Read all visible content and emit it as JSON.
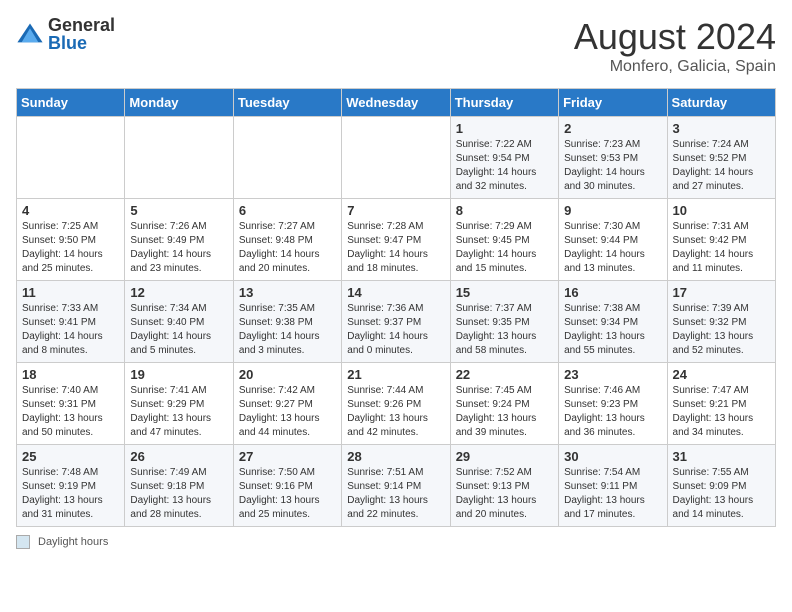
{
  "logo": {
    "general": "General",
    "blue": "Blue"
  },
  "title": {
    "month_year": "August 2024",
    "location": "Monfero, Galicia, Spain"
  },
  "days_of_week": [
    "Sunday",
    "Monday",
    "Tuesday",
    "Wednesday",
    "Thursday",
    "Friday",
    "Saturday"
  ],
  "weeks": [
    [
      {
        "day": "",
        "sunrise": "",
        "sunset": "",
        "daylight": ""
      },
      {
        "day": "",
        "sunrise": "",
        "sunset": "",
        "daylight": ""
      },
      {
        "day": "",
        "sunrise": "",
        "sunset": "",
        "daylight": ""
      },
      {
        "day": "",
        "sunrise": "",
        "sunset": "",
        "daylight": ""
      },
      {
        "day": "1",
        "sunrise": "Sunrise: 7:22 AM",
        "sunset": "Sunset: 9:54 PM",
        "daylight": "Daylight: 14 hours and 32 minutes."
      },
      {
        "day": "2",
        "sunrise": "Sunrise: 7:23 AM",
        "sunset": "Sunset: 9:53 PM",
        "daylight": "Daylight: 14 hours and 30 minutes."
      },
      {
        "day": "3",
        "sunrise": "Sunrise: 7:24 AM",
        "sunset": "Sunset: 9:52 PM",
        "daylight": "Daylight: 14 hours and 27 minutes."
      }
    ],
    [
      {
        "day": "4",
        "sunrise": "Sunrise: 7:25 AM",
        "sunset": "Sunset: 9:50 PM",
        "daylight": "Daylight: 14 hours and 25 minutes."
      },
      {
        "day": "5",
        "sunrise": "Sunrise: 7:26 AM",
        "sunset": "Sunset: 9:49 PM",
        "daylight": "Daylight: 14 hours and 23 minutes."
      },
      {
        "day": "6",
        "sunrise": "Sunrise: 7:27 AM",
        "sunset": "Sunset: 9:48 PM",
        "daylight": "Daylight: 14 hours and 20 minutes."
      },
      {
        "day": "7",
        "sunrise": "Sunrise: 7:28 AM",
        "sunset": "Sunset: 9:47 PM",
        "daylight": "Daylight: 14 hours and 18 minutes."
      },
      {
        "day": "8",
        "sunrise": "Sunrise: 7:29 AM",
        "sunset": "Sunset: 9:45 PM",
        "daylight": "Daylight: 14 hours and 15 minutes."
      },
      {
        "day": "9",
        "sunrise": "Sunrise: 7:30 AM",
        "sunset": "Sunset: 9:44 PM",
        "daylight": "Daylight: 14 hours and 13 minutes."
      },
      {
        "day": "10",
        "sunrise": "Sunrise: 7:31 AM",
        "sunset": "Sunset: 9:42 PM",
        "daylight": "Daylight: 14 hours and 11 minutes."
      }
    ],
    [
      {
        "day": "11",
        "sunrise": "Sunrise: 7:33 AM",
        "sunset": "Sunset: 9:41 PM",
        "daylight": "Daylight: 14 hours and 8 minutes."
      },
      {
        "day": "12",
        "sunrise": "Sunrise: 7:34 AM",
        "sunset": "Sunset: 9:40 PM",
        "daylight": "Daylight: 14 hours and 5 minutes."
      },
      {
        "day": "13",
        "sunrise": "Sunrise: 7:35 AM",
        "sunset": "Sunset: 9:38 PM",
        "daylight": "Daylight: 14 hours and 3 minutes."
      },
      {
        "day": "14",
        "sunrise": "Sunrise: 7:36 AM",
        "sunset": "Sunset: 9:37 PM",
        "daylight": "Daylight: 14 hours and 0 minutes."
      },
      {
        "day": "15",
        "sunrise": "Sunrise: 7:37 AM",
        "sunset": "Sunset: 9:35 PM",
        "daylight": "Daylight: 13 hours and 58 minutes."
      },
      {
        "day": "16",
        "sunrise": "Sunrise: 7:38 AM",
        "sunset": "Sunset: 9:34 PM",
        "daylight": "Daylight: 13 hours and 55 minutes."
      },
      {
        "day": "17",
        "sunrise": "Sunrise: 7:39 AM",
        "sunset": "Sunset: 9:32 PM",
        "daylight": "Daylight: 13 hours and 52 minutes."
      }
    ],
    [
      {
        "day": "18",
        "sunrise": "Sunrise: 7:40 AM",
        "sunset": "Sunset: 9:31 PM",
        "daylight": "Daylight: 13 hours and 50 minutes."
      },
      {
        "day": "19",
        "sunrise": "Sunrise: 7:41 AM",
        "sunset": "Sunset: 9:29 PM",
        "daylight": "Daylight: 13 hours and 47 minutes."
      },
      {
        "day": "20",
        "sunrise": "Sunrise: 7:42 AM",
        "sunset": "Sunset: 9:27 PM",
        "daylight": "Daylight: 13 hours and 44 minutes."
      },
      {
        "day": "21",
        "sunrise": "Sunrise: 7:44 AM",
        "sunset": "Sunset: 9:26 PM",
        "daylight": "Daylight: 13 hours and 42 minutes."
      },
      {
        "day": "22",
        "sunrise": "Sunrise: 7:45 AM",
        "sunset": "Sunset: 9:24 PM",
        "daylight": "Daylight: 13 hours and 39 minutes."
      },
      {
        "day": "23",
        "sunrise": "Sunrise: 7:46 AM",
        "sunset": "Sunset: 9:23 PM",
        "daylight": "Daylight: 13 hours and 36 minutes."
      },
      {
        "day": "24",
        "sunrise": "Sunrise: 7:47 AM",
        "sunset": "Sunset: 9:21 PM",
        "daylight": "Daylight: 13 hours and 34 minutes."
      }
    ],
    [
      {
        "day": "25",
        "sunrise": "Sunrise: 7:48 AM",
        "sunset": "Sunset: 9:19 PM",
        "daylight": "Daylight: 13 hours and 31 minutes."
      },
      {
        "day": "26",
        "sunrise": "Sunrise: 7:49 AM",
        "sunset": "Sunset: 9:18 PM",
        "daylight": "Daylight: 13 hours and 28 minutes."
      },
      {
        "day": "27",
        "sunrise": "Sunrise: 7:50 AM",
        "sunset": "Sunset: 9:16 PM",
        "daylight": "Daylight: 13 hours and 25 minutes."
      },
      {
        "day": "28",
        "sunrise": "Sunrise: 7:51 AM",
        "sunset": "Sunset: 9:14 PM",
        "daylight": "Daylight: 13 hours and 22 minutes."
      },
      {
        "day": "29",
        "sunrise": "Sunrise: 7:52 AM",
        "sunset": "Sunset: 9:13 PM",
        "daylight": "Daylight: 13 hours and 20 minutes."
      },
      {
        "day": "30",
        "sunrise": "Sunrise: 7:54 AM",
        "sunset": "Sunset: 9:11 PM",
        "daylight": "Daylight: 13 hours and 17 minutes."
      },
      {
        "day": "31",
        "sunrise": "Sunrise: 7:55 AM",
        "sunset": "Sunset: 9:09 PM",
        "daylight": "Daylight: 13 hours and 14 minutes."
      }
    ]
  ],
  "footer": {
    "label": "Daylight hours"
  }
}
